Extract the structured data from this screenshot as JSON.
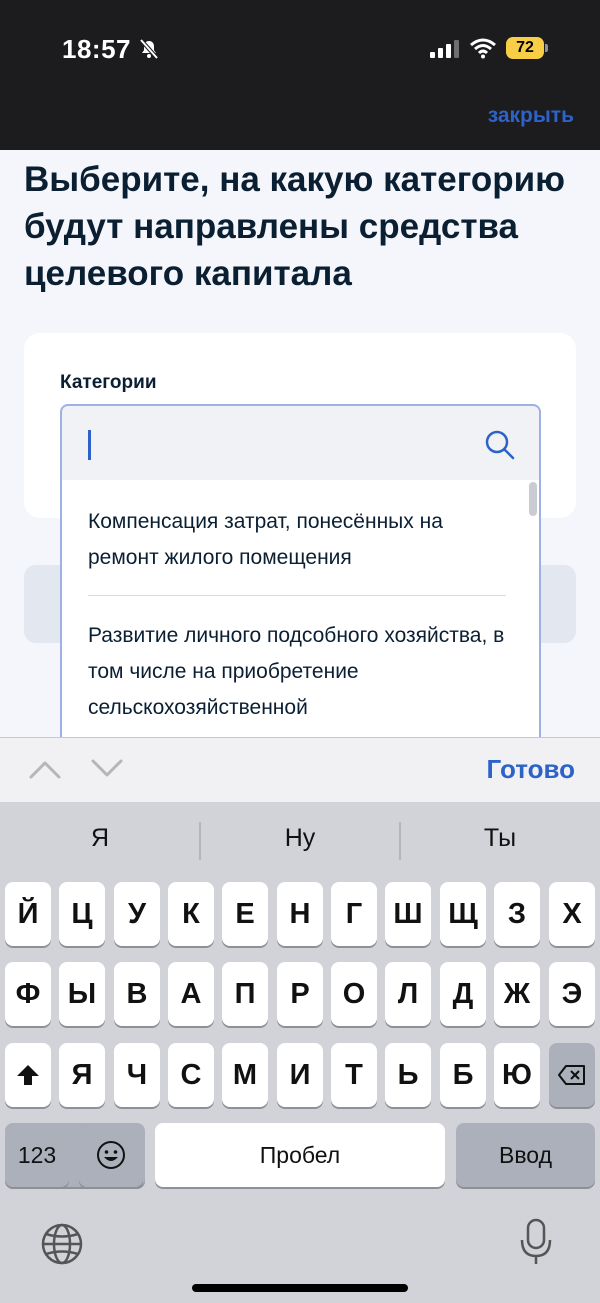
{
  "status_bar": {
    "time": "18:57",
    "battery_level": "72",
    "icons": [
      "bell-muted-icon",
      "signal-icon",
      "wifi-icon",
      "battery-icon"
    ]
  },
  "header": {
    "close_label": "закрыть"
  },
  "page": {
    "title": "Выберите, на какую категорию будут направлены средства целевого капитала"
  },
  "form": {
    "label": "Категории",
    "search_value": "",
    "options": [
      "Компенсация затрат, понесённых на ремонт жилого помещения",
      "Развитие личного подсобного хозяйства, в том числе на приобретение сельскохозяйственной"
    ]
  },
  "accessory_bar": {
    "done_label": "Готово"
  },
  "keyboard": {
    "suggestions": [
      "Я",
      "Ну",
      "Ты"
    ],
    "row1": [
      "Й",
      "Ц",
      "У",
      "К",
      "Е",
      "Н",
      "Г",
      "Ш",
      "Щ",
      "З",
      "Х"
    ],
    "row2": [
      "Ф",
      "Ы",
      "В",
      "А",
      "П",
      "Р",
      "О",
      "Л",
      "Д",
      "Ж",
      "Э"
    ],
    "row3": [
      "Я",
      "Ч",
      "С",
      "М",
      "И",
      "Т",
      "Ь",
      "Б",
      "Ю"
    ],
    "numbers_label": "123",
    "space_label": "Пробел",
    "return_label": "Ввод"
  },
  "colors": {
    "accent": "#2d63c8",
    "title": "#0b1f33",
    "battery": "#f7ce46"
  }
}
